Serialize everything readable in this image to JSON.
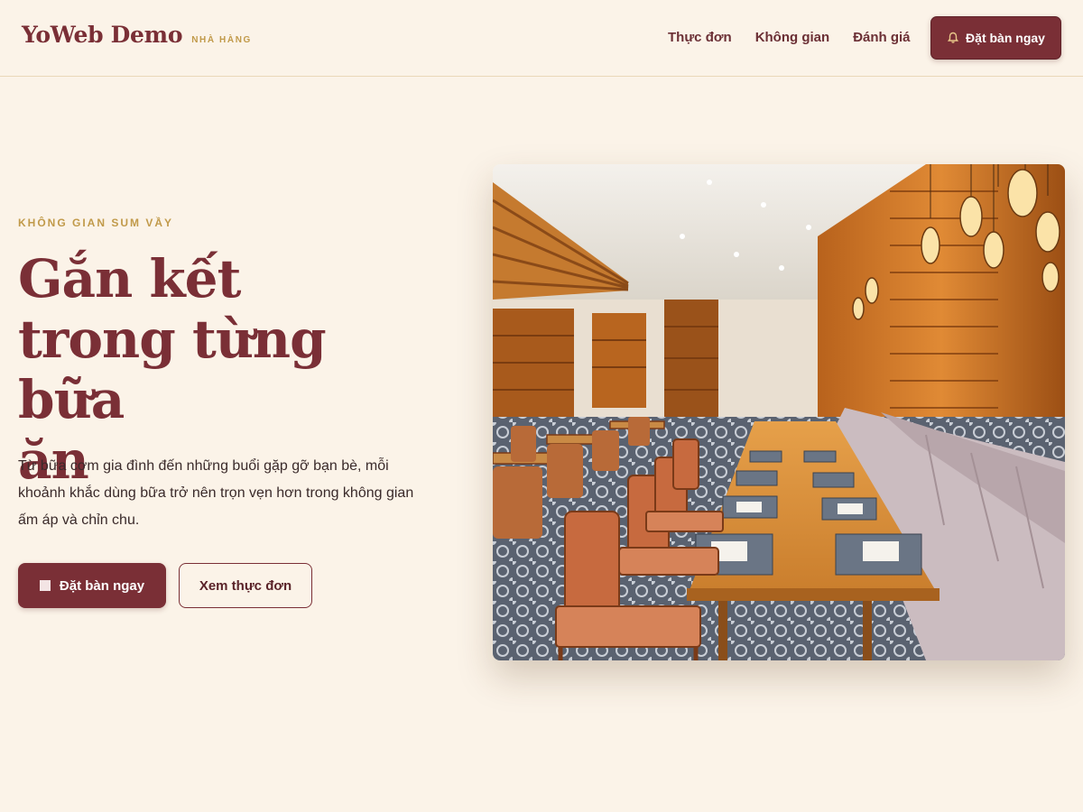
{
  "header": {
    "brand": "YoWeb Demo",
    "brand_sub": "NHÀ HÀNG",
    "nav": [
      "Thực đơn",
      "Không gian",
      "Đánh giá"
    ],
    "cta_label": "Đặt bàn ngay",
    "cta_icon": "bell-icon"
  },
  "hero": {
    "eyebrow": "KHÔNG GIAN SUM VẦY",
    "headline_line1": "Gắn kết",
    "headline_line2": "trong từng bữa",
    "headline_line3": "ăn",
    "lead": "Từ bữa cơm gia đình đến những buổi gặp gỡ bạn bè, mỗi khoảnh khắc dùng bữa trở nên trọn vẹn hơn trong không gian ấm áp và chỉn chu.",
    "primary_label": "Đặt bàn ngay",
    "primary_icon": "square-icon",
    "secondary_label": "Xem thực đơn"
  },
  "colors": {
    "background": "#fbf3e8",
    "brand": "#7a2f36",
    "accent_gold": "#c19a4a"
  }
}
